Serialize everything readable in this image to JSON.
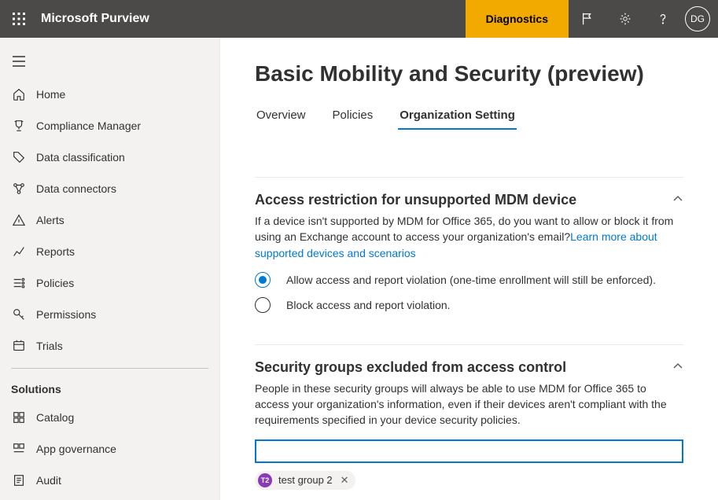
{
  "brand": "Microsoft Purview",
  "topbar": {
    "diagnostics_label": "Diagnostics",
    "avatar_initials": "DG"
  },
  "sidebar": {
    "items": [
      {
        "label": "Home"
      },
      {
        "label": "Compliance Manager"
      },
      {
        "label": "Data classification"
      },
      {
        "label": "Data connectors"
      },
      {
        "label": "Alerts"
      },
      {
        "label": "Reports"
      },
      {
        "label": "Policies"
      },
      {
        "label": "Permissions"
      },
      {
        "label": "Trials"
      }
    ],
    "solutions_heading": "Solutions",
    "solutions": [
      {
        "label": "Catalog"
      },
      {
        "label": "App governance"
      },
      {
        "label": "Audit"
      }
    ]
  },
  "page": {
    "title": "Basic Mobility and Security (preview)",
    "tabs": [
      {
        "label": "Overview"
      },
      {
        "label": "Policies"
      },
      {
        "label": "Organization Setting"
      }
    ],
    "active_tab": "Organization Setting"
  },
  "sections": {
    "access_restriction": {
      "title": "Access restriction for unsupported MDM device",
      "desc": "If a device isn't supported by MDM for Office 365, do you want to allow or block it from using an Exchange account to access your organization's email?",
      "link_text": "Learn more about supported devices and scenarios",
      "options": [
        "Allow access and report violation (one-time enrollment will still be enforced).",
        "Block access and report violation."
      ],
      "selected_index": 0
    },
    "excluded_groups": {
      "title": "Security groups excluded from access control",
      "desc": "People in these security groups will always be able to use MDM for Office 365 to access your organization's information, even if their devices aren't compliant with the requirements specified in your device security policies.",
      "search_value": "",
      "tags": [
        {
          "badge": "T2",
          "badge_color": "#8a3ab9",
          "label": "test group 2"
        }
      ]
    }
  }
}
